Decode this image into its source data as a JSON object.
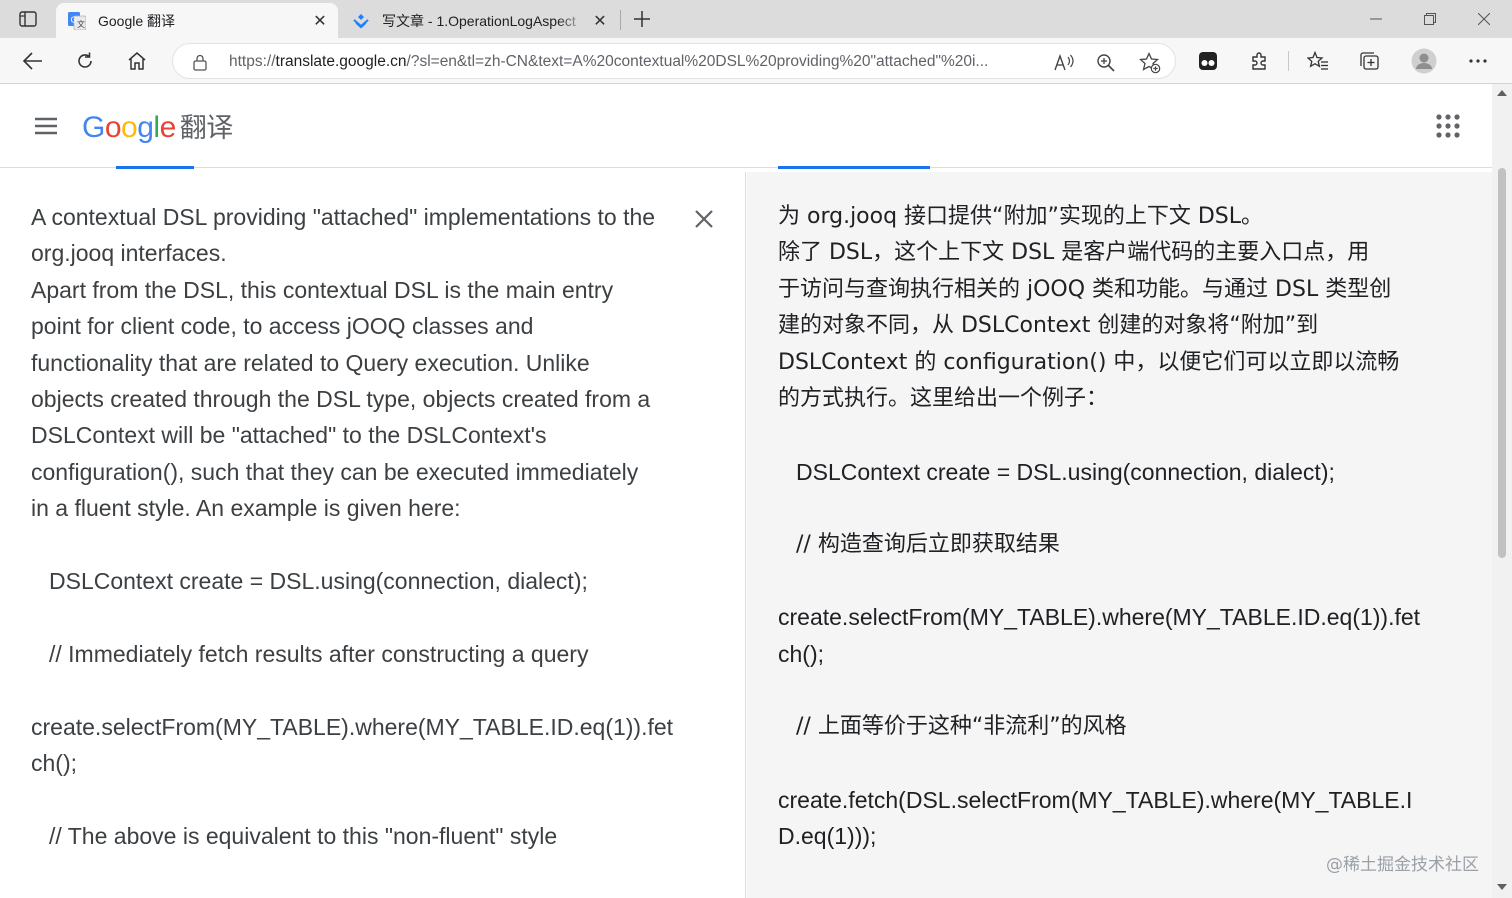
{
  "browser": {
    "tabs": [
      {
        "title": "Google 翻译",
        "active": true
      },
      {
        "title": "写文章 - 1.OperationLogAspect",
        "active": false
      }
    ],
    "url_host_prefix": "https://",
    "url_host": "translate.google.cn",
    "url_rest": "/?sl=en&tl=zh-CN&text=A%20contextual%20DSL%20providing%20\"attached\"%20i..."
  },
  "header": {
    "logo_letters": [
      "G",
      "o",
      "o",
      "g",
      "l",
      "e"
    ],
    "service_name": "翻译"
  },
  "source": {
    "text_lines": [
      "A contextual DSL providing \"attached\" implementations to the",
      "org.jooq interfaces.",
      "Apart from the DSL, this contextual DSL is the main entry",
      "point for client code, to access jOOQ classes and",
      "functionality that are related to Query execution. Unlike",
      "objects created through the DSL type, objects created from a",
      "DSLContext will be \"attached\" to the DSLContext's",
      "configuration(), such that they can be executed immediately",
      "in a fluent style. An example is given here:"
    ],
    "code_1": "DSLContext create = DSL.using(connection, dialect);",
    "comment_1": "// Immediately fetch results after constructing a query",
    "code_2_lines": [
      "create.selectFrom(MY_TABLE).where(MY_TABLE.ID.eq(1)).fet",
      "ch();"
    ],
    "comment_2": "// The above is equivalent to this \"non-fluent\" style"
  },
  "translation": {
    "text_lines": [
      "为 org.jooq 接口提供“附加”实现的上下文 DSL。",
      "除了 DSL，这个上下文 DSL 是客户端代码的主要入口点，用",
      "于访问与查询执行相关的 jOOQ 类和功能。与通过 DSL 类型创",
      "建的对象不同，从 DSLContext 创建的对象将“附加”到",
      "DSLContext 的 configuration() 中，以便它们可以立即以流畅",
      "的方式执行。这里给出一个例子："
    ],
    "code_1": "DSLContext create = DSL.using(connection, dialect);",
    "comment_1": "// 构造查询后立即获取结果",
    "code_2_lines": [
      "create.selectFrom(MY_TABLE).where(MY_TABLE.ID.eq(1)).fet",
      "ch();"
    ],
    "comment_2": "// 上面等价于这种“非流利”的风格",
    "code_3_lines": [
      "create.fetch(DSL.selectFrom(MY_TABLE).where(MY_TABLE.I",
      "D.eq(1)));"
    ]
  },
  "watermark": "@稀土掘金技术社区",
  "colors": {
    "accent": "#1a73e8",
    "right_panel_bg": "#f5f5f5"
  }
}
